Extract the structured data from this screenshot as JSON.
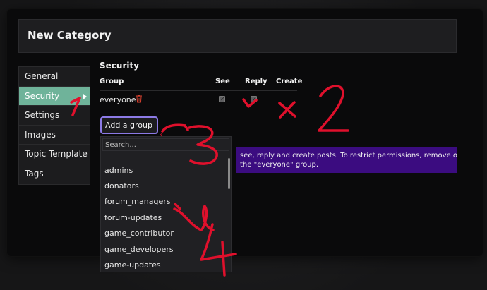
{
  "modal": {
    "title": "New Category"
  },
  "nav": {
    "items": [
      {
        "label": "General"
      },
      {
        "label": "Security"
      },
      {
        "label": "Settings"
      },
      {
        "label": "Images"
      },
      {
        "label": "Topic Template"
      },
      {
        "label": "Tags"
      }
    ],
    "active_index": 1
  },
  "security": {
    "title": "Security",
    "columns": {
      "group": "Group",
      "see": "See",
      "reply": "Reply",
      "create": "Create"
    },
    "rows": [
      {
        "group": "everyone",
        "see": true,
        "reply": true,
        "create": false
      }
    ],
    "add_group_label": "Add a group"
  },
  "dropdown": {
    "search_placeholder": "Search...",
    "options": [
      "admins",
      "donators",
      "forum_managers",
      "forum-updates",
      "game_contributor",
      "game_developers",
      "game-updates"
    ]
  },
  "info": {
    "line1": "see, reply and create posts. To restrict permissions, remove one",
    "line2": "the \"everyone\" group."
  },
  "annotations": [
    "1",
    "2",
    "3",
    "4"
  ],
  "colors": {
    "accent_nav": "#6fb39a",
    "button_border": "#8c7ae6",
    "info_bar": "#3b0c80",
    "annotation": "#e0102c",
    "trash": "#d8412f"
  }
}
